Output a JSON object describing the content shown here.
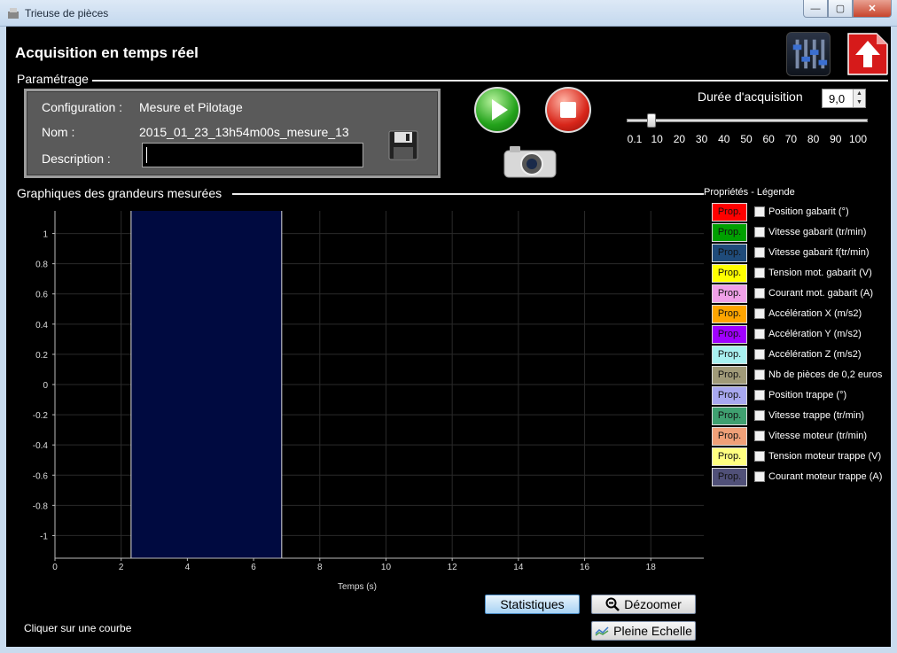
{
  "window": {
    "title": "Trieuse de pièces",
    "minimize": "—",
    "maximize": "▢",
    "close": "✕"
  },
  "page_title": "Acquisition en temps réel",
  "sections": {
    "params": "Paramétrage",
    "graphs": "Graphiques des grandeurs mesurées"
  },
  "config": {
    "configuration_label": "Configuration :",
    "configuration_value": "Mesure et Pilotage",
    "name_label": "Nom :",
    "name_value": "2015_01_23_13h54m00s_mesure_13",
    "description_label": "Description :",
    "description_value": ""
  },
  "duration": {
    "label": "Durée d'acquisition",
    "value": "9,0",
    "slider_value": 9.0,
    "ticks": [
      "0.1",
      "10",
      "20",
      "30",
      "40",
      "50",
      "60",
      "70",
      "80",
      "90",
      "100"
    ]
  },
  "legend": {
    "title": "Propriétés - Légende",
    "prop_label": "Prop.",
    "items": [
      {
        "label": "Position gabarit (°)",
        "color": "#ff0000"
      },
      {
        "label": "Vitesse gabarit (tr/min)",
        "color": "#00a000"
      },
      {
        "label": "Vitesse gabarit f(tr/min)",
        "color": "#1f4b7a"
      },
      {
        "label": "Tension mot. gabarit (V)",
        "color": "#ffff00"
      },
      {
        "label": "Courant mot. gabarit (A)",
        "color": "#f0a0e8"
      },
      {
        "label": "Accélération X (m/s2)",
        "color": "#ffa500"
      },
      {
        "label": "Accélération Y (m/s2)",
        "color": "#a000ff"
      },
      {
        "label": "Accélération Z (m/s2)",
        "color": "#a8f0f0"
      },
      {
        "label": "Nb de pièces de 0,2 euros",
        "color": "#a09a78"
      },
      {
        "label": "Position trappe (°)",
        "color": "#a8a8f0"
      },
      {
        "label": "Vitesse trappe (tr/min)",
        "color": "#3fa070"
      },
      {
        "label": "Vitesse moteur (tr/min)",
        "color": "#f0a078"
      },
      {
        "label": "Tension moteur trappe (V)",
        "color": "#ffff80"
      },
      {
        "label": "Courant moteur trappe (A)",
        "color": "#505078"
      }
    ]
  },
  "chart_data": {
    "type": "line",
    "xlabel": "Temps (s)",
    "ylabel": "",
    "xlim": [
      0,
      19.6
    ],
    "ylim": [
      -1.15,
      1.15
    ],
    "xticks": [
      0,
      2,
      4,
      6,
      8,
      10,
      12,
      14,
      16,
      18
    ],
    "yticks": [
      1,
      0.8,
      0.6,
      0.4,
      0.2,
      0,
      -0.2,
      -0.4,
      -0.6,
      -0.8,
      -1
    ],
    "grid": true,
    "highlight_range": [
      2.3,
      6.85
    ],
    "highlight_color": "#000a40",
    "series": []
  },
  "buttons": {
    "statistics": "Statistiques",
    "unzoom": "Dézoomer",
    "full_scale": "Pleine Echelle"
  },
  "status": "Cliquer sur une courbe"
}
